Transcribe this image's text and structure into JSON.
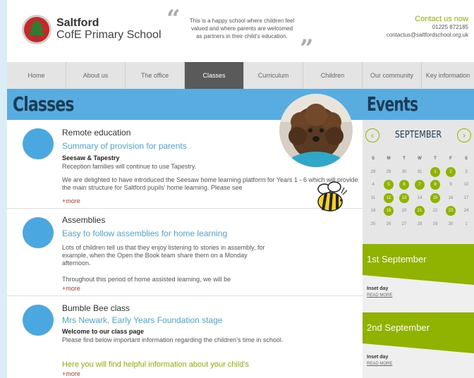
{
  "header": {
    "school_name": "Saltford",
    "school_sub": "CofE Primary School",
    "tagline": "This is a happy school where children feel valued and where parents are welcomed as partners in their child's education.",
    "contact_title": "Contact us now",
    "phone": "01225 872185",
    "email": "contactus@saltfordschool.org.uk"
  },
  "nav": [
    {
      "label": "Home"
    },
    {
      "label": "About us"
    },
    {
      "label": "The office"
    },
    {
      "label": "Classes",
      "active": true
    },
    {
      "label": "Curriculum"
    },
    {
      "label": "Children"
    },
    {
      "label": "Our community"
    },
    {
      "label": "Key information"
    }
  ],
  "main": {
    "title": "Classes",
    "posts": [
      {
        "title": "Remote education",
        "subtitle": "Summary of provision for parents",
        "bold": "Seesaw & Tapestry",
        "line1": "Reception families will continue to use Tapestry.",
        "para": "We are delighted to have introduced the Seesaw home learning platform for Years 1 - 6 which will provide the main structure for Saltford pupils' home learning. Please see",
        "more": "+more"
      },
      {
        "title": "Assemblies",
        "subtitle": "Easy to follow assemblies for home learning",
        "para": "Lots of children tell us that they enjoy listening to stories in assembly, for example, when the Open the Book team share them on a Monday afternoon.",
        "para2": "Throughout this period of home assisted learning, we will be",
        "more": "+more"
      },
      {
        "title": "Bumble Bee class",
        "subtitle": "Mrs Newark, Early Years Foundation stage",
        "bold": "Welcome to our class page",
        "para": "Please find below important information regarding the children's time in school.",
        "green": "Here you will find helpful information about your child's",
        "more": "+more"
      }
    ]
  },
  "events": {
    "title": "Events",
    "month": "SEPTEMBER",
    "weekdays": [
      "S",
      "M",
      "T",
      "W",
      "T",
      "F",
      "S"
    ],
    "weeks": [
      [
        {
          "d": "28"
        },
        {
          "d": "29"
        },
        {
          "d": "30"
        },
        {
          "d": "31"
        },
        {
          "d": "1",
          "hl": true
        },
        {
          "d": "2",
          "hl": true
        },
        {
          "d": "3"
        }
      ],
      [
        {
          "d": "4"
        },
        {
          "d": "5",
          "hl": true
        },
        {
          "d": "6",
          "hl": true
        },
        {
          "d": "7",
          "hl": true
        },
        {
          "d": "8",
          "hl": true
        },
        {
          "d": "9"
        },
        {
          "d": "10"
        }
      ],
      [
        {
          "d": "11"
        },
        {
          "d": "12",
          "hl": true
        },
        {
          "d": "13",
          "hl": true
        },
        {
          "d": "14"
        },
        {
          "d": "15",
          "hl": true
        },
        {
          "d": "16"
        },
        {
          "d": "17"
        }
      ],
      [
        {
          "d": "18"
        },
        {
          "d": "19",
          "hl": true
        },
        {
          "d": "20"
        },
        {
          "d": "21",
          "hl": true
        },
        {
          "d": "22"
        },
        {
          "d": "23",
          "hl": true
        },
        {
          "d": "24"
        }
      ],
      [
        {
          "d": "25"
        },
        {
          "d": "26"
        },
        {
          "d": "27"
        },
        {
          "d": "28"
        },
        {
          "d": "29"
        },
        {
          "d": "30"
        },
        {
          "d": "1"
        }
      ]
    ],
    "items": [
      {
        "date": "1st September",
        "name": "Inset day",
        "more": "READ MORE"
      },
      {
        "date": "2nd September",
        "name": "Inset day",
        "more": "READ MORE"
      }
    ]
  },
  "colors": {
    "accent_blue": "#58acdf",
    "accent_green": "#8fb300",
    "nav_active": "#5a5a5a"
  },
  "icons": {
    "logo": "school-crest-icon",
    "quote_open": "open-quote-icon",
    "quote_close": "close-quote-icon",
    "prev": "chevron-left-icon",
    "next": "chevron-right-icon",
    "bee": "bee-icon"
  }
}
